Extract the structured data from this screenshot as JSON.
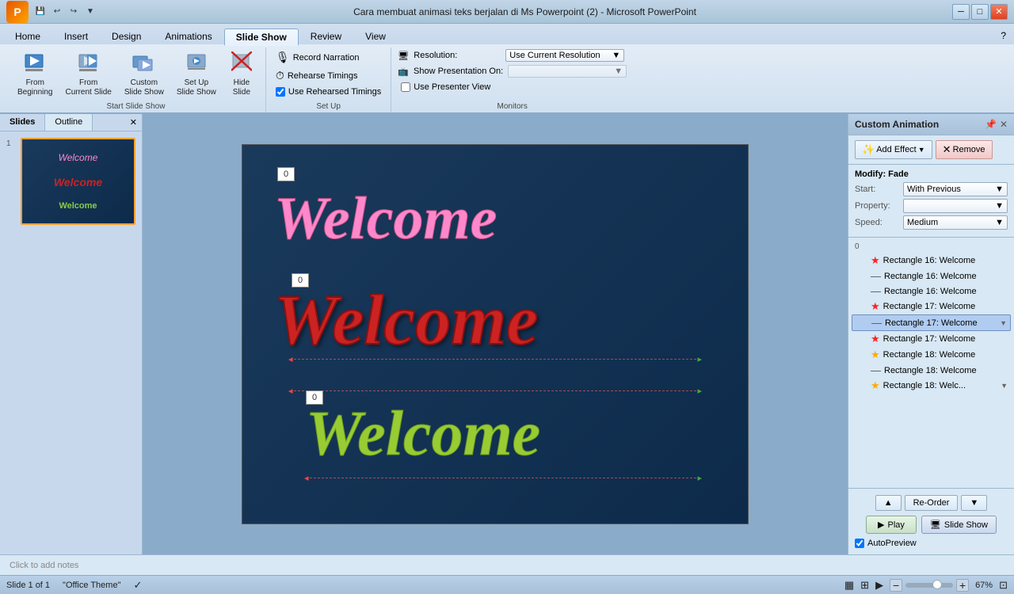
{
  "titlebar": {
    "title": "Cara membuat animasi teks berjalan di Ms Powerpoint (2) - Microsoft PowerPoint",
    "min_label": "─",
    "max_label": "□",
    "close_label": "✕"
  },
  "quickaccess": {
    "save_label": "💾",
    "undo_label": "↩",
    "redo_label": "↪",
    "dropdown_label": "▼"
  },
  "tabs": [
    {
      "label": "Home",
      "active": false
    },
    {
      "label": "Insert",
      "active": false
    },
    {
      "label": "Design",
      "active": false
    },
    {
      "label": "Animations",
      "active": false
    },
    {
      "label": "Slide Show",
      "active": true
    },
    {
      "label": "Review",
      "active": false
    },
    {
      "label": "View",
      "active": false
    }
  ],
  "ribbon": {
    "groups": {
      "start_slideshow": {
        "label": "Start Slide Show",
        "from_beginning": "From\nBeginning",
        "from_current": "From\nCurrent Slide",
        "custom_slideshow": "Custom\nSlide Show",
        "setup_slide": "Set Up\nSlide Show",
        "hide_slide": "Hide\nSlide"
      },
      "setup": {
        "label": "Set Up",
        "record_narration": "Record Narration",
        "rehearse_timings": "Rehearse Timings",
        "use_rehearsed": "Use Rehearsed Timings"
      },
      "monitors": {
        "label": "Monitors",
        "resolution_label": "Resolution:",
        "resolution_value": "Use Current Resolution",
        "show_on_label": "Show Presentation On:",
        "show_on_value": "",
        "presenter_view": "Use Presenter View"
      }
    }
  },
  "slides_panel": {
    "tabs": [
      "Slides",
      "Outline"
    ],
    "active_tab": "Slides",
    "slides": [
      {
        "num": "1",
        "texts": [
          "Welcome",
          "Welcome",
          "Welcome"
        ]
      }
    ]
  },
  "canvas": {
    "welcome_texts": [
      "Welcome",
      "Welcome",
      "Welcome"
    ],
    "counters": [
      "0",
      "0",
      "0"
    ]
  },
  "animation_panel": {
    "title": "Custom Animation",
    "add_effect_label": "Add Effect",
    "remove_label": "Remove",
    "modify_label": "Modify: Fade",
    "start_label": "Start:",
    "start_value": "With Previous",
    "property_label": "Property:",
    "speed_label": "Speed:",
    "speed_value": "Medium",
    "list_items": [
      {
        "num": "0",
        "icon": "star",
        "icon_type": "star-red",
        "text": "Rectangle 16: Welcome",
        "selected": false,
        "has_dropdown": false
      },
      {
        "num": "",
        "icon": "—",
        "icon_type": "dash",
        "text": "Rectangle 16: Welcome",
        "selected": false,
        "has_dropdown": false
      },
      {
        "num": "",
        "icon": "—",
        "icon_type": "dash",
        "text": "Rectangle 16: Welcome",
        "selected": false,
        "has_dropdown": false
      },
      {
        "num": "",
        "icon": "★",
        "icon_type": "star-red",
        "text": "Rectangle 17: Welcome",
        "selected": false,
        "has_dropdown": false
      },
      {
        "num": "",
        "icon": "—",
        "icon_type": "dash",
        "text": "Rectangle 17: Welcome",
        "selected": true,
        "has_dropdown": false
      },
      {
        "num": "",
        "icon": "★",
        "icon_type": "star-red",
        "text": "Rectangle 17: Welcome",
        "selected": false,
        "has_dropdown": false
      },
      {
        "num": "",
        "icon": "★",
        "icon_type": "star-gold",
        "text": "Rectangle 18: Welcome",
        "selected": false,
        "has_dropdown": false
      },
      {
        "num": "",
        "icon": "—",
        "icon_type": "dash",
        "text": "Rectangle 18: Welcome",
        "selected": false,
        "has_dropdown": false
      },
      {
        "num": "",
        "icon": "★",
        "icon_type": "star-gold",
        "text": "Rectangle 18: Welc...",
        "selected": false,
        "has_dropdown": true
      }
    ],
    "reorder_label": "Re-Order",
    "play_label": "Play",
    "slideshow_label": "Slide Show",
    "autopreview_label": "AutoPreview"
  },
  "notes": {
    "placeholder": "Click to add notes"
  },
  "statusbar": {
    "slide_info": "Slide 1 of 1",
    "theme": "\"Office Theme\"",
    "zoom": "67%"
  }
}
